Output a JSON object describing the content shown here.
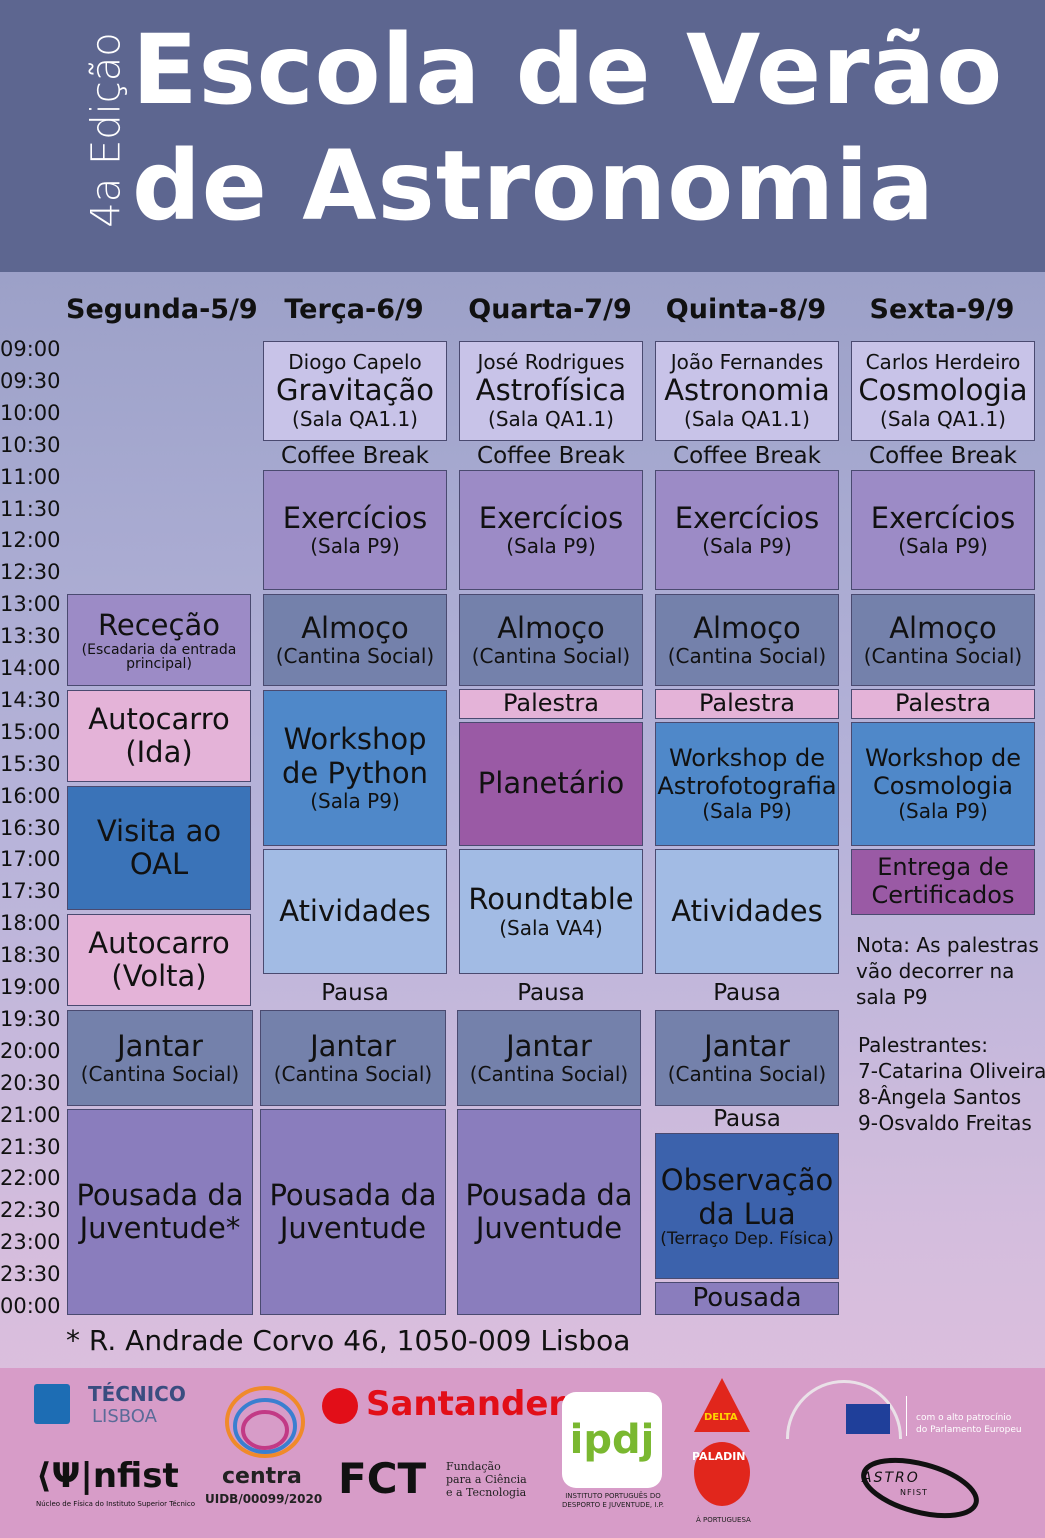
{
  "header": {
    "edition": "4a Edição",
    "title_line1": "Escola de Verão",
    "title_line2": "de Astronomia"
  },
  "days": [
    "Segunda-5/9",
    "Terça-6/9",
    "Quarta-7/9",
    "Quinta-8/9",
    "Sexta-9/9"
  ],
  "times": [
    "09:00",
    "09:30",
    "10:00",
    "10:30",
    "11:00",
    "11:30",
    "12:00",
    "12:30",
    "13:00",
    "13:30",
    "14:00",
    "14:30",
    "15:00",
    "15:30",
    "16:00",
    "16:30",
    "17:00",
    "17:30",
    "18:00",
    "18:30",
    "19:00",
    "19:30",
    "20:00",
    "20:30",
    "21:00",
    "21:30",
    "22:00",
    "22:30",
    "23:00",
    "23:30",
    "00:00"
  ],
  "schedule": {
    "ter": {
      "lecture": {
        "speaker": "Diogo Capelo",
        "topic": "Gravitação",
        "room": "(Sala QA1.1)"
      },
      "coffee": "Coffee Break",
      "exercises": {
        "title": "Exercícios",
        "room": "(Sala P9)"
      },
      "lunch": {
        "title": "Almoço",
        "room": "(Cantina Social)"
      },
      "workshop": {
        "line1": "Workshop",
        "line2": "de Python",
        "room": "(Sala P9)"
      },
      "activities": "Atividades",
      "pause": "Pausa",
      "dinner": {
        "title": "Jantar",
        "room": "(Cantina Social)"
      },
      "lodging": {
        "line1": "Pousada da",
        "line2": "Juventude"
      }
    },
    "qua": {
      "lecture": {
        "speaker": "José Rodrigues",
        "topic": "Astrofísica",
        "room": "(Sala QA1.1)"
      },
      "coffee": "Coffee Break",
      "exercises": {
        "title": "Exercícios",
        "room": "(Sala P9)"
      },
      "lunch": {
        "title": "Almoço",
        "room": "(Cantina Social)"
      },
      "talk": "Palestra",
      "planetarium": "Planetário",
      "roundtable": {
        "title": "Roundtable",
        "room": "(Sala VA4)"
      },
      "pause": "Pausa",
      "dinner": {
        "title": "Jantar",
        "room": "(Cantina Social)"
      },
      "lodging": {
        "line1": "Pousada da",
        "line2": "Juventude"
      }
    },
    "qui": {
      "lecture": {
        "speaker": "João Fernandes",
        "topic": "Astronomia",
        "room": "(Sala QA1.1)"
      },
      "coffee": "Coffee Break",
      "exercises": {
        "title": "Exercícios",
        "room": "(Sala P9)"
      },
      "lunch": {
        "title": "Almoço",
        "room": "(Cantina Social)"
      },
      "talk": "Palestra",
      "workshop": {
        "line1": "Workshop de",
        "line2": "Astrofotografia",
        "room": "(Sala P9)"
      },
      "activities": "Atividades",
      "pause": "Pausa",
      "dinner": {
        "title": "Jantar",
        "room": "(Cantina Social)"
      },
      "pause2": "Pausa",
      "moon": {
        "line1": "Observação",
        "line2": "da Lua",
        "room": "(Terraço Dep. Física)"
      },
      "lodging": "Pousada"
    },
    "sex": {
      "lecture": {
        "speaker": "Carlos Herdeiro",
        "topic": "Cosmologia",
        "room": "(Sala QA1.1)"
      },
      "coffee": "Coffee Break",
      "exercises": {
        "title": "Exercícios",
        "room": "(Sala P9)"
      },
      "lunch": {
        "title": "Almoço",
        "room": "(Cantina Social)"
      },
      "talk": "Palestra",
      "workshop": {
        "line1": "Workshop de",
        "line2": "Cosmologia",
        "room": "(Sala P9)"
      },
      "certificates": {
        "line1": "Entrega de",
        "line2": "Certificados"
      }
    },
    "seg": {
      "reception": {
        "title": "Receção",
        "sub1": "(Escadaria da entrada",
        "sub2": "principal)"
      },
      "bus_go": {
        "line1": "Autocarro",
        "line2": "(Ida)"
      },
      "visit": {
        "line1": "Visita ao",
        "line2": "OAL"
      },
      "bus_back": {
        "line1": "Autocarro",
        "line2": "(Volta)"
      },
      "dinner": {
        "title": "Jantar",
        "room": "(Cantina Social)"
      },
      "lodging": {
        "line1": "Pousada da",
        "line2": "Juventude*"
      }
    }
  },
  "notes": {
    "note_l1": "Nota: As palestras",
    "note_l2": "vão decorrer na",
    "note_l3": "sala P9",
    "speakers_title": "Palestrantes:",
    "speaker7": "7-Catarina Oliveira",
    "speaker8": "8-Ângela Santos",
    "speaker9": "9-Osvaldo Freitas"
  },
  "address": "* R. Andrade Corvo 46, 1050-009 Lisboa",
  "footer": {
    "tecnico_l1": "TÉCNICO",
    "tecnico_l2": "LISBOA",
    "nfist": "⟨Ψ|nfist",
    "nfist_sub": "Núcleo de Física do Instituto Superior Técnico",
    "centra": "centra",
    "centra_code": "UIDB/00099/2020",
    "santander": "Santander",
    "fct": "FCT",
    "fct_sub1": "Fundação",
    "fct_sub2": "para a Ciência",
    "fct_sub3": "e a Tecnologia",
    "ipdj": "ipdj",
    "ipdj_sub1": "INSTITUTO PORTUGUÊS DO",
    "ipdj_sub2": "DESPORTO E JUVENTUDE, I.P.",
    "delta": "DELTA",
    "paladin": "PALADIN",
    "paladin_sub": "À PORTUGUESA",
    "ep_l1": "com o alto patrocínio",
    "ep_l2": "do Parlamento Europeu",
    "astro": "ASTRO",
    "astro_sub": "NFIST"
  },
  "colors": {
    "header": "#5d6690",
    "footer": "#d79cc8",
    "lecture": "#c8c3e8",
    "exercises": "#9c8bc6",
    "lunch": "#7481ab",
    "pink": "#e4b3d8",
    "workshop": "#4f88c9",
    "activities": "#a2bbe4",
    "planetarium": "#9a5aa5",
    "lodging": "#8a7dbd",
    "moon": "#3c62ac"
  }
}
